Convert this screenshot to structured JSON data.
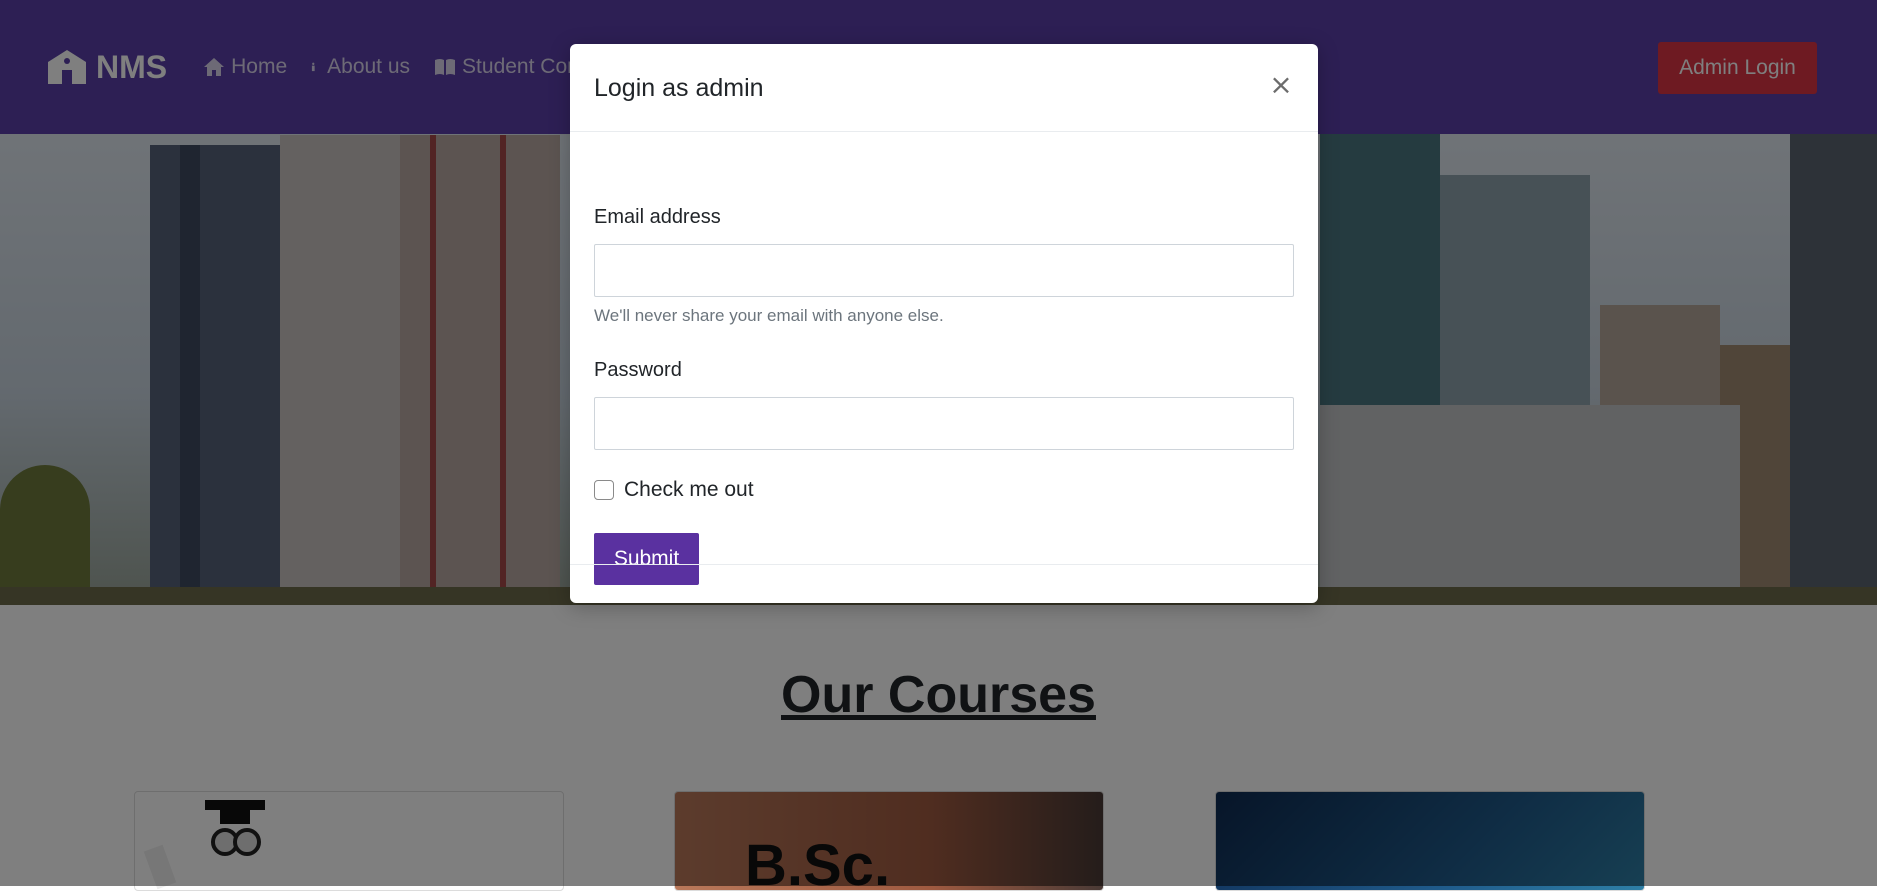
{
  "navbar": {
    "brand": "NMS",
    "links": [
      {
        "label": "Home",
        "icon": "home-icon"
      },
      {
        "label": "About us",
        "icon": "info-icon"
      },
      {
        "label": "Student Cor",
        "icon": "book-icon"
      }
    ],
    "admin_button": "Admin Login"
  },
  "courses": {
    "title": "Our Courses",
    "card_texts": [
      "B.Sc."
    ]
  },
  "modal": {
    "title": "Login as admin",
    "close_label": "×",
    "email_label": "Email address",
    "email_value": "",
    "email_help": "We'll never share your email with anyone else.",
    "password_label": "Password",
    "password_value": "",
    "checkbox_label": "Check me out",
    "checkbox_checked": false,
    "submit_label": "Submit"
  },
  "colors": {
    "navbar": "#5a3fa8",
    "admin_button": "#dc3545",
    "submit_button": "#5a31a0"
  }
}
